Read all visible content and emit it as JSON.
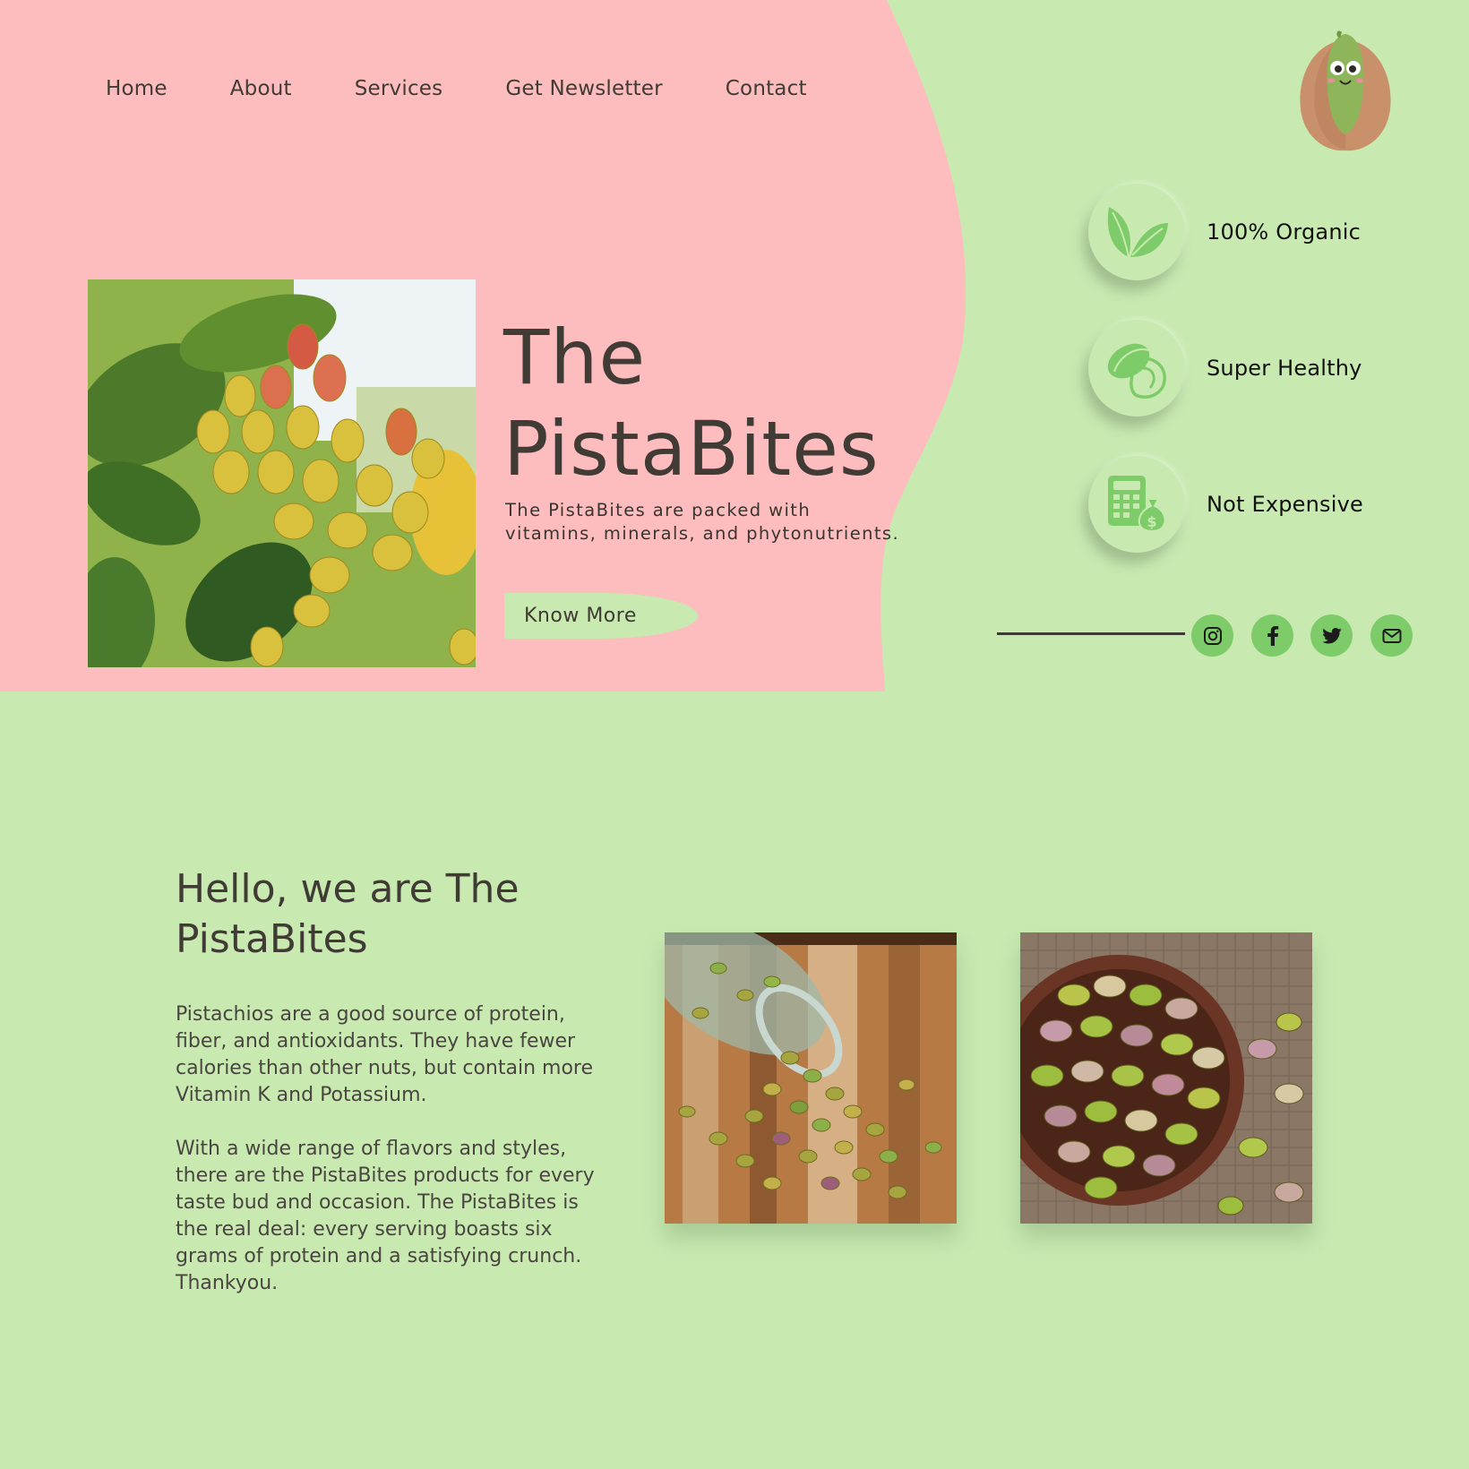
{
  "nav": {
    "items": [
      {
        "label": "Home"
      },
      {
        "label": "About"
      },
      {
        "label": "Services"
      },
      {
        "label": "Get Newsletter"
      },
      {
        "label": "Contact"
      }
    ]
  },
  "hero": {
    "title_line1": "The",
    "title_line2": "PistaBites",
    "description": "The PistaBites are packed with vitamins, minerals, and phytonutrients.",
    "cta_label": "Know More"
  },
  "features": [
    {
      "label": "100% Organic",
      "icon": "leaf-icon"
    },
    {
      "label": "Super Healthy",
      "icon": "pistachio-icon"
    },
    {
      "label": "Not Expensive",
      "icon": "calculator-money-icon"
    }
  ],
  "social": [
    "instagram-icon",
    "facebook-icon",
    "twitter-icon",
    "mail-icon"
  ],
  "about": {
    "title": "Hello, we are The PistaBites",
    "paragraph1": "Pistachios are a good source of protein, fiber, and antioxidants. They have fewer calories than other nuts, but contain more Vitamin K and Potassium.",
    "paragraph2": "With a wide range of flavors and styles, there are the PistaBites products for every taste bud and occasion. The PistaBites is the real deal: every serving boasts six grams of protein and a satisfying crunch. Thankyou."
  },
  "colors": {
    "pink": "#fdbcbe",
    "green": "#c8eab1",
    "accent_green": "#7ecb69",
    "dark_text": "#403b35"
  }
}
